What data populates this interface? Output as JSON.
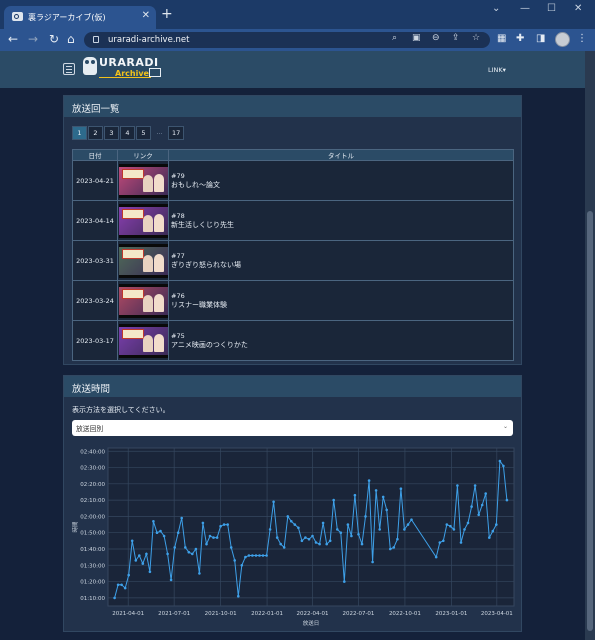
{
  "browser": {
    "tab_title": "裏ラジアーカイブ(仮)",
    "tab_close": "✕",
    "new_tab": "+",
    "url": "uraradi-archive.net",
    "back": "←",
    "forward": "→",
    "reload": "↻",
    "home": "⌂",
    "window_controls": [
      "⌄",
      "—",
      "☐",
      "✕"
    ]
  },
  "site": {
    "logo_text": "URARADI",
    "logo_sub": "Archive",
    "link_menu": "LINK▾"
  },
  "episodes_card": {
    "title": "放送回一覧",
    "pages": [
      "1",
      "2",
      "3",
      "4",
      "5",
      "...",
      "17"
    ],
    "active_page": "1",
    "columns": [
      "日付",
      "リンク",
      "タイトル"
    ],
    "rows": [
      {
        "date": "2023-04-21",
        "num": "#79",
        "title": "おもしれ～論文",
        "thumb_color": "#c24a7a"
      },
      {
        "date": "2023-04-14",
        "num": "#78",
        "title": "新生活しくじり先生",
        "thumb_color": "#8a3fb0"
      },
      {
        "date": "2023-03-31",
        "num": "#77",
        "title": "ぎりぎり怒られない場",
        "thumb_color": "#4f6b58"
      },
      {
        "date": "2023-03-24",
        "num": "#76",
        "title": "リスナー職業体験",
        "thumb_color": "#b04a63"
      },
      {
        "date": "2023-03-17",
        "num": "#75",
        "title": "アニメ映画のつくりかた",
        "thumb_color": "#7b3fae"
      }
    ]
  },
  "duration_card": {
    "title": "放送時間",
    "hint": "表示方法を選択してください。",
    "select_value": "放送回別",
    "select_caret": "⌄"
  },
  "chart_data": {
    "type": "line",
    "xlabel": "放送日",
    "ylabel": "時間",
    "x_ticks": [
      "2021-04-01",
      "2021-07-01",
      "2021-10-01",
      "2022-01-01",
      "2022-04-01",
      "2022-07-01",
      "2022-10-01",
      "2023-01-01",
      "2023-04-01"
    ],
    "y_ticks": [
      "01:10:00",
      "01:20:00",
      "01:30:00",
      "01:40:00",
      "01:50:00",
      "02:00:00",
      "02:10:00",
      "02:20:00",
      "02:30:00",
      "02:40:00"
    ],
    "xlim": [
      "2021-02-20",
      "2023-05-05"
    ],
    "ylim_minutes": [
      65,
      162
    ],
    "color": "#3ea0e8",
    "grid": true,
    "points": [
      [
        "2021-03-05",
        70
      ],
      [
        "2021-03-12",
        78
      ],
      [
        "2021-03-19",
        78
      ],
      [
        "2021-03-26",
        76
      ],
      [
        "2021-04-02",
        84
      ],
      [
        "2021-04-09",
        105
      ],
      [
        "2021-04-16",
        93
      ],
      [
        "2021-04-23",
        96
      ],
      [
        "2021-04-30",
        91
      ],
      [
        "2021-05-07",
        97
      ],
      [
        "2021-05-14",
        86
      ],
      [
        "2021-05-21",
        117
      ],
      [
        "2021-05-28",
        110
      ],
      [
        "2021-06-04",
        111
      ],
      [
        "2021-06-11",
        108
      ],
      [
        "2021-06-18",
        97
      ],
      [
        "2021-06-25",
        81
      ],
      [
        "2021-07-02",
        101
      ],
      [
        "2021-07-09",
        110
      ],
      [
        "2021-07-16",
        119
      ],
      [
        "2021-07-23",
        101
      ],
      [
        "2021-07-30",
        98
      ],
      [
        "2021-08-06",
        97
      ],
      [
        "2021-08-13",
        100
      ],
      [
        "2021-08-20",
        85
      ],
      [
        "2021-08-27",
        116
      ],
      [
        "2021-09-03",
        103
      ],
      [
        "2021-09-10",
        108
      ],
      [
        "2021-09-17",
        107
      ],
      [
        "2021-09-24",
        107
      ],
      [
        "2021-10-01",
        114
      ],
      [
        "2021-10-08",
        115
      ],
      [
        "2021-10-15",
        115
      ],
      [
        "2021-10-22",
        101
      ],
      [
        "2021-10-29",
        93
      ],
      [
        "2021-11-05",
        71
      ],
      [
        "2021-11-12",
        90
      ],
      [
        "2021-11-19",
        95
      ],
      [
        "2021-11-26",
        96
      ],
      [
        "2021-12-03",
        96
      ],
      [
        "2021-12-10",
        96
      ],
      [
        "2021-12-17",
        96
      ],
      [
        "2021-12-24",
        96
      ],
      [
        "2021-12-31",
        96
      ],
      [
        "2022-01-07",
        112
      ],
      [
        "2022-01-14",
        129
      ],
      [
        "2022-01-21",
        107
      ],
      [
        "2022-01-28",
        103
      ],
      [
        "2022-02-04",
        101
      ],
      [
        "2022-02-11",
        120
      ],
      [
        "2022-02-18",
        117
      ],
      [
        "2022-02-25",
        115
      ],
      [
        "2022-03-04",
        113
      ],
      [
        "2022-03-11",
        105
      ],
      [
        "2022-03-18",
        107
      ],
      [
        "2022-03-25",
        106
      ],
      [
        "2022-04-01",
        108
      ],
      [
        "2022-04-08",
        104
      ],
      [
        "2022-04-15",
        103
      ],
      [
        "2022-04-22",
        116
      ],
      [
        "2022-04-29",
        103
      ],
      [
        "2022-05-06",
        105
      ],
      [
        "2022-05-13",
        130
      ],
      [
        "2022-05-20",
        112
      ],
      [
        "2022-05-27",
        110
      ],
      [
        "2022-06-03",
        80
      ],
      [
        "2022-06-10",
        115
      ],
      [
        "2022-06-17",
        108
      ],
      [
        "2022-06-24",
        133
      ],
      [
        "2022-07-01",
        109
      ],
      [
        "2022-07-08",
        103
      ],
      [
        "2022-07-15",
        120
      ],
      [
        "2022-07-22",
        142
      ],
      [
        "2022-07-29",
        92
      ],
      [
        "2022-08-05",
        136
      ],
      [
        "2022-08-12",
        112
      ],
      [
        "2022-08-19",
        132
      ],
      [
        "2022-08-26",
        124
      ],
      [
        "2022-09-02",
        100
      ],
      [
        "2022-09-09",
        101
      ],
      [
        "2022-09-16",
        106
      ],
      [
        "2022-09-23",
        137
      ],
      [
        "2022-09-30",
        112
      ],
      [
        "2022-10-07",
        115
      ],
      [
        "2022-10-14",
        118
      ],
      [
        "2022-12-02",
        95
      ],
      [
        "2022-12-09",
        104
      ],
      [
        "2022-12-16",
        105
      ],
      [
        "2022-12-23",
        115
      ],
      [
        "2022-12-30",
        114
      ],
      [
        "2023-01-06",
        112
      ],
      [
        "2023-01-13",
        139
      ],
      [
        "2023-01-20",
        104
      ],
      [
        "2023-01-27",
        112
      ],
      [
        "2023-02-03",
        116
      ],
      [
        "2023-02-10",
        126
      ],
      [
        "2023-02-17",
        139
      ],
      [
        "2023-02-24",
        121
      ],
      [
        "2023-03-03",
        127
      ],
      [
        "2023-03-10",
        134
      ],
      [
        "2023-03-17",
        107
      ],
      [
        "2023-03-24",
        111
      ],
      [
        "2023-03-31",
        115
      ],
      [
        "2023-04-07",
        154
      ],
      [
        "2023-04-14",
        151
      ],
      [
        "2023-04-21",
        130
      ]
    ]
  }
}
